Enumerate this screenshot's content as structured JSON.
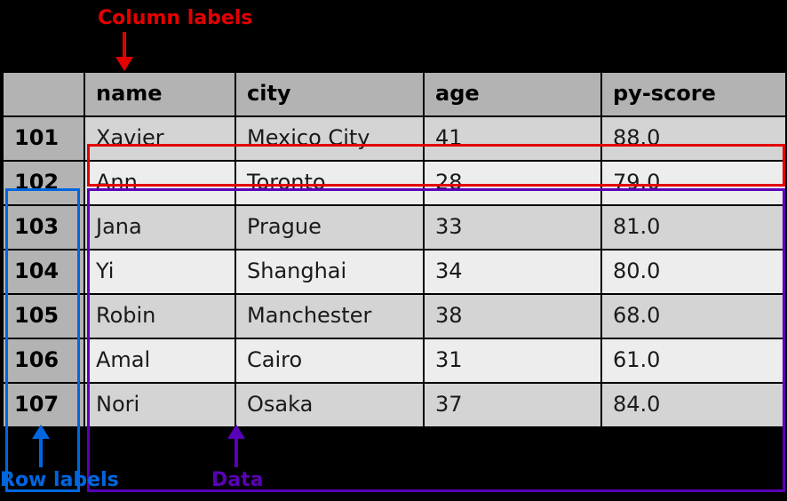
{
  "annotations": {
    "columns_label": "Column labels",
    "rows_label": "Row labels",
    "data_label": "Data"
  },
  "table": {
    "columns": [
      "name",
      "city",
      "age",
      "py-score"
    ],
    "index": [
      "101",
      "102",
      "103",
      "104",
      "105",
      "106",
      "107"
    ],
    "rows": [
      {
        "name": "Xavier",
        "city": "Mexico City",
        "age": "41",
        "py_score": "88.0"
      },
      {
        "name": "Ann",
        "city": "Toronto",
        "age": "28",
        "py_score": "79.0"
      },
      {
        "name": "Jana",
        "city": "Prague",
        "age": "33",
        "py_score": "81.0"
      },
      {
        "name": "Yi",
        "city": "Shanghai",
        "age": "34",
        "py_score": "80.0"
      },
      {
        "name": "Robin",
        "city": "Manchester",
        "age": "38",
        "py_score": "68.0"
      },
      {
        "name": "Amal",
        "city": "Cairo",
        "age": "31",
        "py_score": "61.0"
      },
      {
        "name": "Nori",
        "city": "Osaka",
        "age": "37",
        "py_score": "84.0"
      }
    ]
  }
}
